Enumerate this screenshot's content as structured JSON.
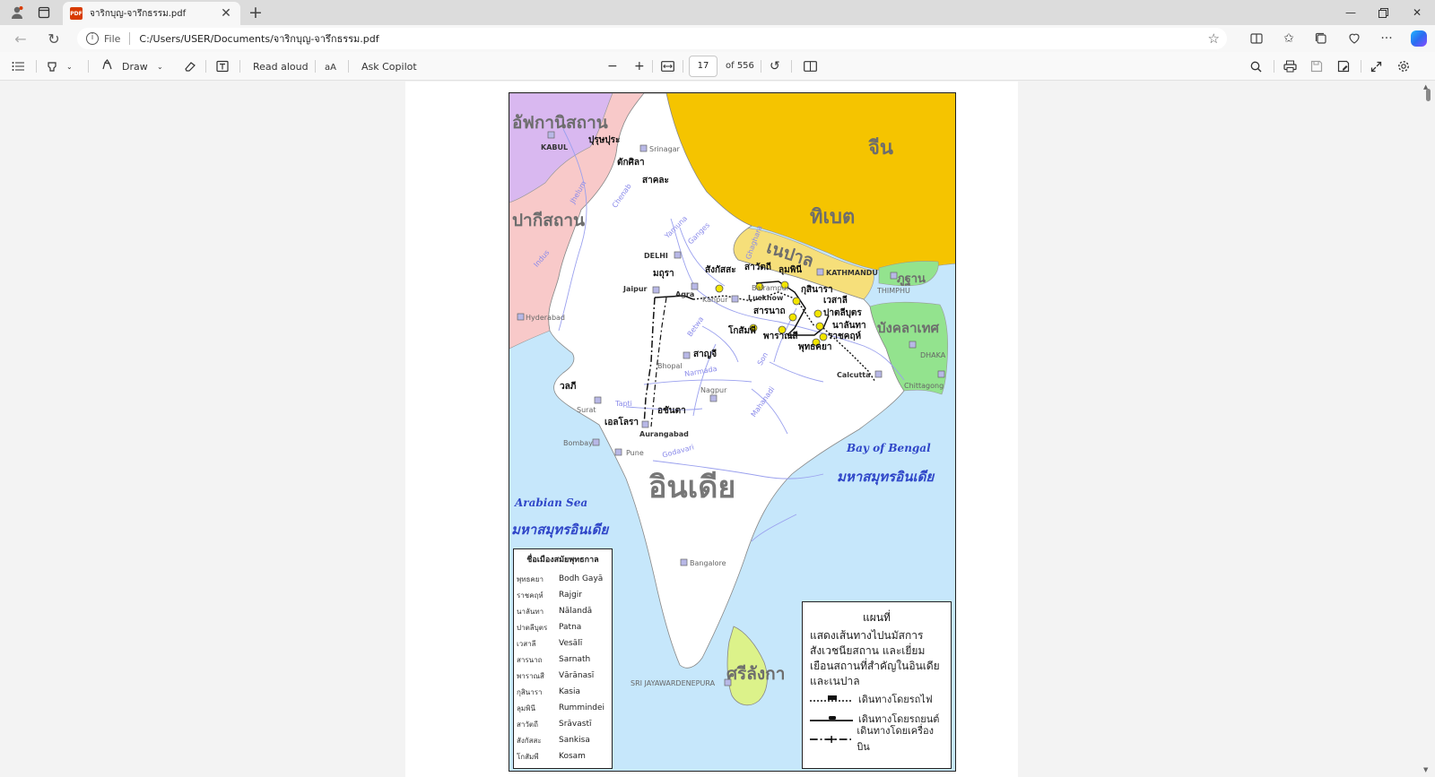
{
  "browser": {
    "tab_title": "จาริกบุญ-จารึกธรรม.pdf",
    "tab_badge": "PDF",
    "url_scheme": "File",
    "url": "C:/Users/USER/Documents/จาริกบุญ-จารึกธรรม.pdf"
  },
  "pdf_toolbar": {
    "draw_label": "Draw",
    "read_aloud_label": "Read aloud",
    "ask_copilot_label": "Ask Copilot",
    "current_page": "17",
    "total_pages": "of 556"
  },
  "map": {
    "countries": {
      "afghanistan": "อัฟกานิสถาน",
      "pakistan": "ปากีสถาน",
      "china": "จีน",
      "tibet": "ทิเบต",
      "nepal": "เนปาล",
      "bhutan": "ภูฐาน",
      "bangladesh": "บังคลาเทศ",
      "india": "อินเดีย",
      "sri_lanka": "ศรีลังกา"
    },
    "seas": {
      "arabian_sea": "Arabian Sea",
      "arabian_sea_th": "มหาสมุทรอินเดีย",
      "bay_of_bengal": "Bay of Bengal",
      "bay_of_bengal_th": "มหาสมุทรอินเดีย"
    },
    "cities_en": {
      "kabul": "KABUL",
      "srinagar": "Srinagar",
      "delhi": "DELHI",
      "jaipur": "Jaipur",
      "agra": "Agra",
      "hyderabad": "Hyderabad",
      "kathmandu": "KATHMANDU",
      "thimphu": "THIMPHU",
      "balrampur": "Balrampur",
      "lucknow": "Lucknow",
      "kanpur": "Kanpur",
      "bhopal": "Bhopal",
      "nagpur": "Nagpur",
      "calcutta": "Calcutta",
      "dhaka": "DHAKA",
      "chittagong": "Chittagong",
      "surat": "Surat",
      "aurangabad": "Aurangabad",
      "bombay": "Bombay",
      "pune": "Pune",
      "bangalore": "Bangalore",
      "sri_jayawardenepura": "SRI JAYAWARDENEPURA"
    },
    "rivers": {
      "yamuna": "Yamuna",
      "ganges": "Ganges",
      "indus": "Indus",
      "narmada": "Narmada",
      "tapti": "Tapti",
      "godavari": "Godavari",
      "mahanadi": "Mahanadi",
      "betwa": "Betwa",
      "son": "Son",
      "jhelum": "Jhelum",
      "chenab": "Chenab",
      "ghaghara": "Ghaghara"
    },
    "cities_th": {
      "purushapura": "ปุรุษปุระ",
      "taxila": "ตักศิลา",
      "sakala": "สาคละ",
      "mathura": "มถุรา",
      "sankassa": "สังกัสสะ",
      "savatthi": "สาวัตถี",
      "lumbini": "ลุมพินี",
      "kusinara": "กุสินารา",
      "vesali": "เวสาลี",
      "pataliputra": "ปาตลีบุตร",
      "nalanda": "นาลันทา",
      "rajagaha": "ราชคฤห์",
      "bodhgaya": "พุทธคยา",
      "varanasi": "พาราณสี",
      "sarnath": "สารนาถ",
      "kosambi": "โกสัมพี",
      "sanchi": "สาญจี",
      "valabhi": "วลภี",
      "ajanta": "อชันตา",
      "ellora": "เอลโลรา"
    },
    "legend_names": {
      "title": "ชื่อเมืองสมัยพุทธกาล",
      "rows": [
        {
          "th": "พุทธคยา",
          "en": "Bodh Gayā"
        },
        {
          "th": "ราชคฤห์",
          "en": "Rajgir"
        },
        {
          "th": "นาลันทา",
          "en": "Nālandā"
        },
        {
          "th": "ปาตลีบุตร",
          "en": "Patna"
        },
        {
          "th": "เวสาลี",
          "en": "Vesālī"
        },
        {
          "th": "สารนาถ",
          "en": "Sarnath"
        },
        {
          "th": "พาราณสี",
          "en": "Vārānasī"
        },
        {
          "th": "กุสินารา",
          "en": "Kasia"
        },
        {
          "th": "ลุมพินี",
          "en": "Rummindei"
        },
        {
          "th": "สาวัตถี",
          "en": "Srāvastī"
        },
        {
          "th": "สังกัสสะ",
          "en": "Sankisa"
        },
        {
          "th": "โกสัมพี",
          "en": "Kosam"
        }
      ]
    },
    "legend_routes": {
      "title": "แผนที่",
      "description": "แสดงเส้นทางไปนมัสการสังเวชนียสถาน และเยี่ยมเยือนสถานที่สำคัญในอินเดียและเนปาล",
      "train": "เดินทางโดยรถไฟ",
      "car": "เดินทางโดยรถยนต์",
      "plane": "เดินทางโดยเครื่องบิน"
    },
    "colors": {
      "afghanistan": "#d9b8f0",
      "pakistan": "#f8c9c9",
      "china_tibet": "#f5c400",
      "nepal": "#f6df7a",
      "bhutan_bangladesh": "#93e38e",
      "sea": "#c6e7fb",
      "sri_lanka": "#dcf28a",
      "sites": "#f2e500"
    }
  }
}
